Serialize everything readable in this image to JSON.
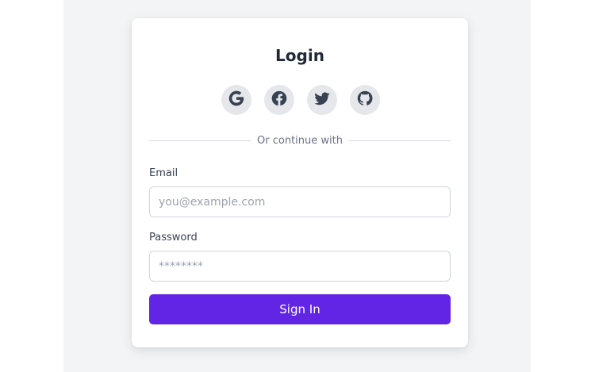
{
  "login": {
    "title": "Login",
    "divider_text": "Or continue with",
    "social": [
      {
        "icon": "google-icon"
      },
      {
        "icon": "facebook-icon"
      },
      {
        "icon": "twitter-icon"
      },
      {
        "icon": "github-icon"
      }
    ],
    "email": {
      "label": "Email",
      "placeholder": "you@example.com",
      "value": ""
    },
    "password": {
      "label": "Password",
      "placeholder": "********",
      "value": ""
    },
    "submit_label": "Sign In"
  },
  "colors": {
    "page_bg": "#f3f4f6",
    "card_bg": "#ffffff",
    "primary": "#6225e6",
    "social_bg": "#e5e7eb",
    "text_dark": "#1f2937",
    "text_muted": "#6b7280",
    "border": "#d1d5db"
  }
}
